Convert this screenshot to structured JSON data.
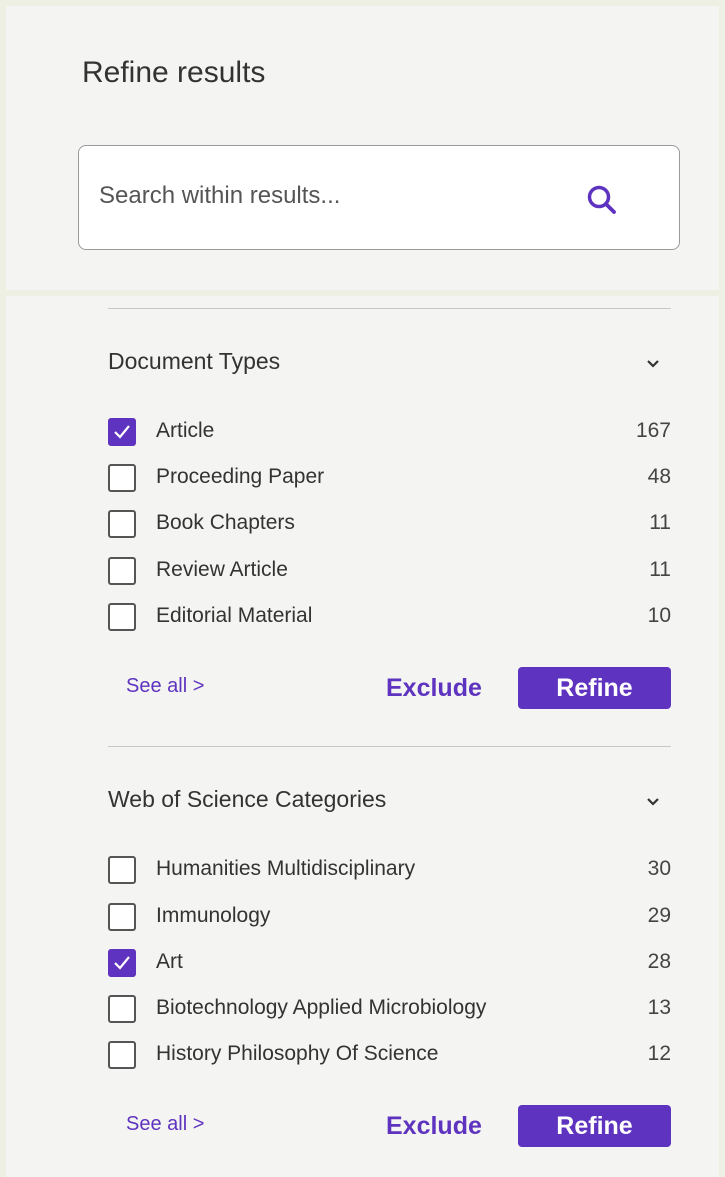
{
  "panel": {
    "title": "Refine results"
  },
  "search": {
    "placeholder": "Search within results..."
  },
  "colors": {
    "accent": "#5e33bf",
    "background": "#eef0e4",
    "panel": "#f4f4f2"
  },
  "sections": [
    {
      "title": "Document Types",
      "expand_icon": "chevron-down-icon",
      "items": [
        {
          "label": "Article",
          "count": "167",
          "checked": true
        },
        {
          "label": "Proceeding Paper",
          "count": "48",
          "checked": false
        },
        {
          "label": "Book Chapters",
          "count": "11",
          "checked": false
        },
        {
          "label": "Review Article",
          "count": "11",
          "checked": false
        },
        {
          "label": "Editorial Material",
          "count": "10",
          "checked": false
        }
      ],
      "see_all": "See all >",
      "exclude": "Exclude",
      "refine": "Refine"
    },
    {
      "title": "Web of Science Categories",
      "expand_icon": "chevron-down-icon",
      "items": [
        {
          "label": "Humanities Multidisciplinary",
          "count": "30",
          "checked": false
        },
        {
          "label": "Immunology",
          "count": "29",
          "checked": false
        },
        {
          "label": "Art",
          "count": "28",
          "checked": true
        },
        {
          "label": "Biotechnology Applied Microbiology",
          "count": "13",
          "checked": false
        },
        {
          "label": "History Philosophy Of Science",
          "count": "12",
          "checked": false
        }
      ],
      "see_all": "See all >",
      "exclude": "Exclude",
      "refine": "Refine"
    }
  ]
}
